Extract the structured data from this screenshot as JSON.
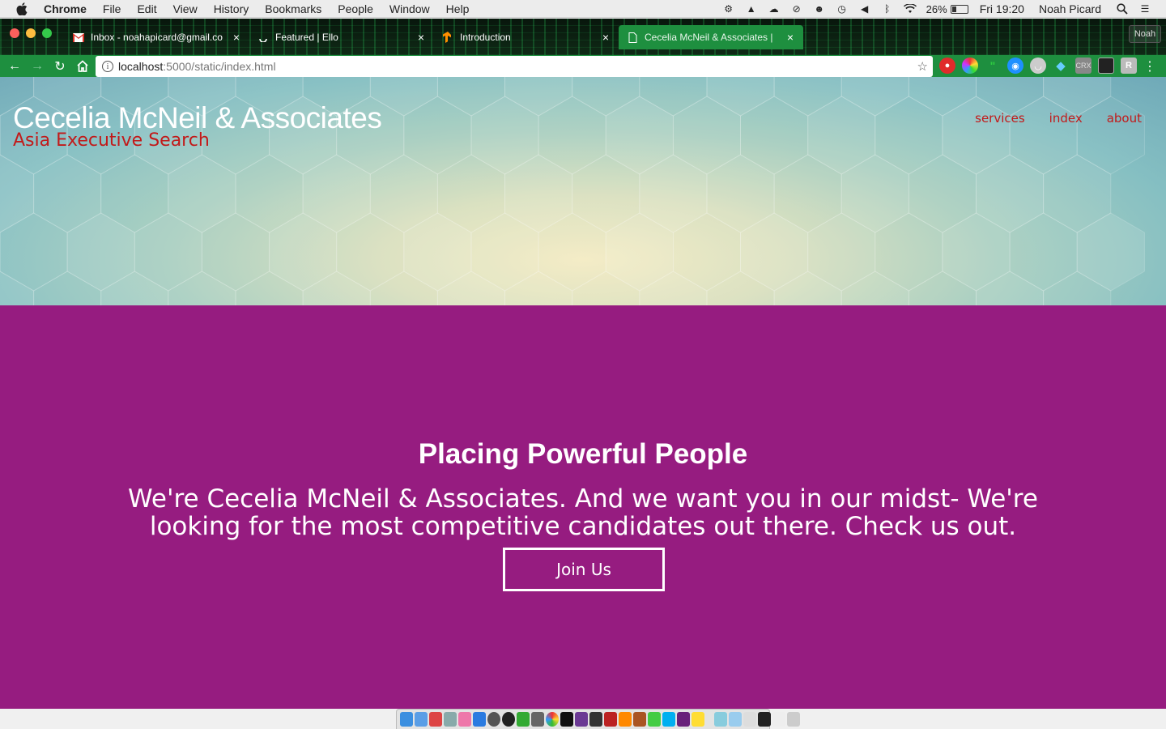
{
  "menubar": {
    "app": "Chrome",
    "items": [
      "File",
      "Edit",
      "View",
      "History",
      "Bookmarks",
      "People",
      "Window",
      "Help"
    ],
    "battery": "26%",
    "battery_level": 0.26,
    "clock": "Fri 19:20",
    "user": "Noah Picard"
  },
  "browser": {
    "tabs": [
      {
        "title": "Inbox - noahapicard@gmail.co",
        "icon": "gmail-icon",
        "active": false
      },
      {
        "title": "Featured | Ello",
        "icon": "loading-spinner-icon",
        "active": false
      },
      {
        "title": "Introduction",
        "icon": "tensorflow-icon",
        "active": false
      },
      {
        "title": "Cecelia McNeil & Associates |",
        "icon": "document-icon",
        "active": true
      }
    ],
    "profile": "Noah",
    "url_host": "localhost",
    "url_path": ":5000/static/index.html",
    "ext_label_crx": "CRX",
    "ext_label_r": "R"
  },
  "page": {
    "brand_title": "Cecelia McNeil & Associates",
    "brand_subtitle": "Asia Executive Search",
    "nav": [
      "services",
      "index",
      "about"
    ],
    "headline": "Placing Powerful People",
    "lead": "We're Cecelia McNeil & Associates. And we want you in our midst- We're looking for the most competitive candidates out there. Check us out.",
    "cta": "Join Us"
  },
  "colors": {
    "chrome_green": "#1e8f3f",
    "purple_section": "#961c80",
    "brand_red": "#c21a1a"
  }
}
